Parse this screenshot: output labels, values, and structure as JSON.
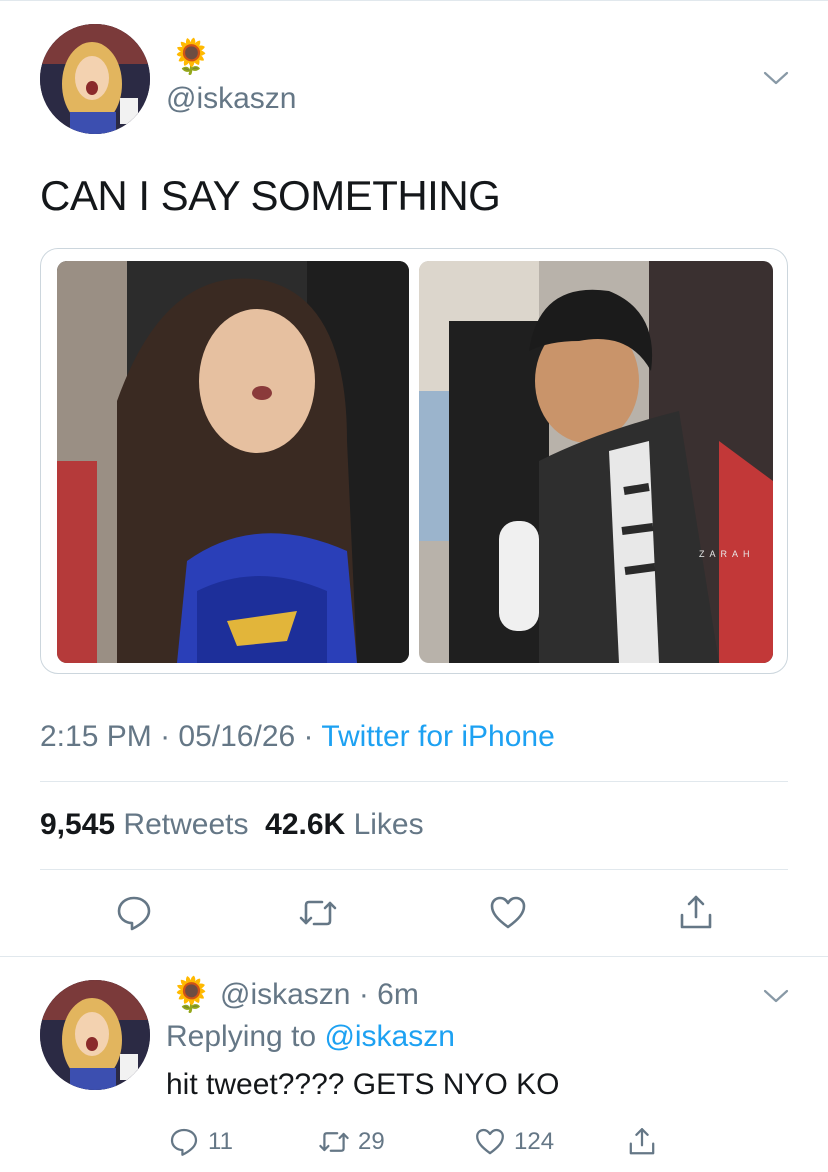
{
  "tweet": {
    "author_emoji": "🌻",
    "handle": "@iskaszn",
    "text": "CAN I SAY SOMETHING",
    "meta": {
      "time": "2:15 PM",
      "separator": " · ",
      "date": "05/16/26",
      "source": "Twitter for iPhone"
    },
    "stats": {
      "retweets_count": "9,545",
      "retweets_label": "Retweets",
      "likes_count": "42.6K",
      "likes_label": "Likes"
    },
    "watermark": "ZARAH"
  },
  "reply": {
    "author_emoji": "🌻",
    "handle": "@iskaszn",
    "age": "6m",
    "replying_label": "Replying to",
    "replying_to": "@iskaszn",
    "text": "hit tweet???? GETS NYO KO",
    "counts": {
      "replies": "11",
      "retweets": "29",
      "likes": "124"
    }
  },
  "icons": {
    "reply": "speech-bubble-icon",
    "retweet": "retweet-arrows-icon",
    "like": "heart-icon",
    "share": "share-arrow-icon",
    "menu": "chevron-down-icon"
  },
  "colors": {
    "text": "#14171a",
    "secondary": "#657786",
    "link": "#1da1f2",
    "divider": "#e1e8ed"
  }
}
